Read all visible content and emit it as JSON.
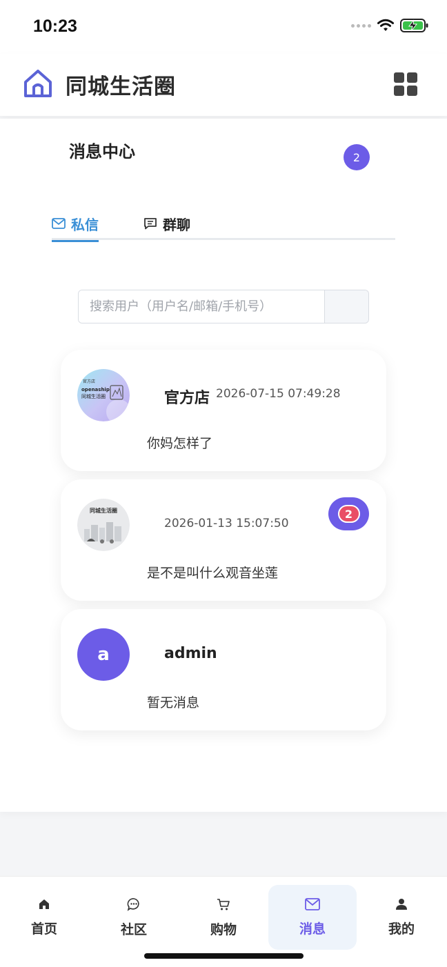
{
  "status_bar": {
    "time": "10:23"
  },
  "header": {
    "title": "同城生活圈"
  },
  "page": {
    "title": "消息中心",
    "unread_total": "2"
  },
  "tabs": [
    {
      "label": "私信",
      "icon": "mail-icon",
      "active": true
    },
    {
      "label": "群聊",
      "icon": "chat-bubble-icon",
      "active": false
    }
  ],
  "search": {
    "placeholder": "搜索用户（用户名/邮箱/手机号）",
    "value": ""
  },
  "conversations": [
    {
      "name": "官方店",
      "time": "2026-07-15 07:49:28",
      "preview": "你妈怎样了",
      "avatar_text": [
        "官方店",
        "openaship",
        "同城生活圈"
      ]
    },
    {
      "name": "",
      "time": "2026-01-13 15:07:50",
      "preview": "是不是叫什么观音坐莲",
      "unread": "2",
      "avatar_text": [
        "同城生活圈"
      ]
    },
    {
      "name": "admin",
      "time": "",
      "preview": "暂无消息",
      "avatar_letter": "a"
    }
  ],
  "bottom_nav": [
    {
      "label": "首页",
      "icon": "home-icon"
    },
    {
      "label": "社区",
      "icon": "comment-icon"
    },
    {
      "label": "购物",
      "icon": "cart-icon"
    },
    {
      "label": "消息",
      "icon": "mail-icon",
      "active": true
    },
    {
      "label": "我的",
      "icon": "user-icon"
    }
  ],
  "colors": {
    "accent": "#6c5ce7",
    "tab_active": "#3a8fd6",
    "badge_red": "#e94e66"
  }
}
